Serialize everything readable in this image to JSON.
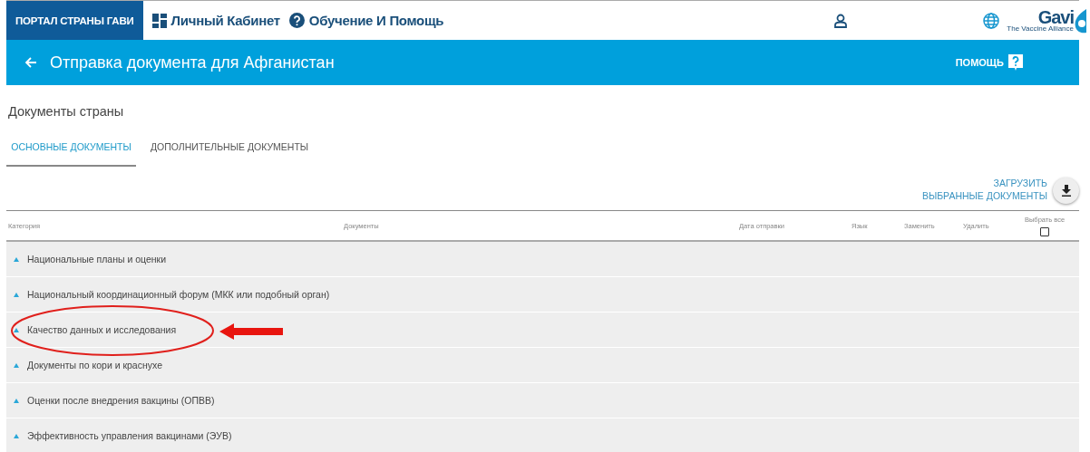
{
  "topbar": {
    "portal": "ПОРТАЛ СТРАНЫ ГАВИ",
    "links": [
      {
        "kind": "dashboard",
        "label": "Личный Кабинет"
      },
      {
        "kind": "help",
        "label": "Обучение И Помощь"
      }
    ],
    "logo": {
      "name": "Gavi",
      "tagline": "The Vaccine Alliance"
    }
  },
  "header": {
    "title": "Отправка документа для Афганистан",
    "help": "ПОМОЩЬ"
  },
  "section_title": "Документы страны",
  "tabs": [
    {
      "label": "ОСНОВНЫЕ ДОКУМЕНТЫ",
      "selected": true
    },
    {
      "label": "ДОПОЛНИТЕЛЬНЫЕ ДОКУМЕНТЫ",
      "selected": false
    }
  ],
  "download": {
    "label_line1": "ЗАГРУЗИТЬ",
    "label_line2": "ВЫБРАННЫЕ ДОКУМЕНТЫ"
  },
  "table": {
    "columns": [
      "Категория",
      "Документы",
      "Дата отправки",
      "Язык",
      "Заменить",
      "Удалить"
    ],
    "select_all": {
      "label": "Выбрать все",
      "checked": false
    },
    "rows": [
      {
        "category": "Национальные планы и оценки",
        "circled": false
      },
      {
        "category": "Национальный координационный форум (МКК или подобный орган)",
        "circled": false
      },
      {
        "category": "Качество данных и исследования",
        "circled": true
      },
      {
        "category": "Документы по кори и краснухе",
        "circled": false
      },
      {
        "category": "Оценки после внедрения вакцины (ОПВВ)",
        "circled": false
      },
      {
        "category": "Эффективность управления вакцинами (ЭУВ)",
        "circled": false
      }
    ]
  }
}
